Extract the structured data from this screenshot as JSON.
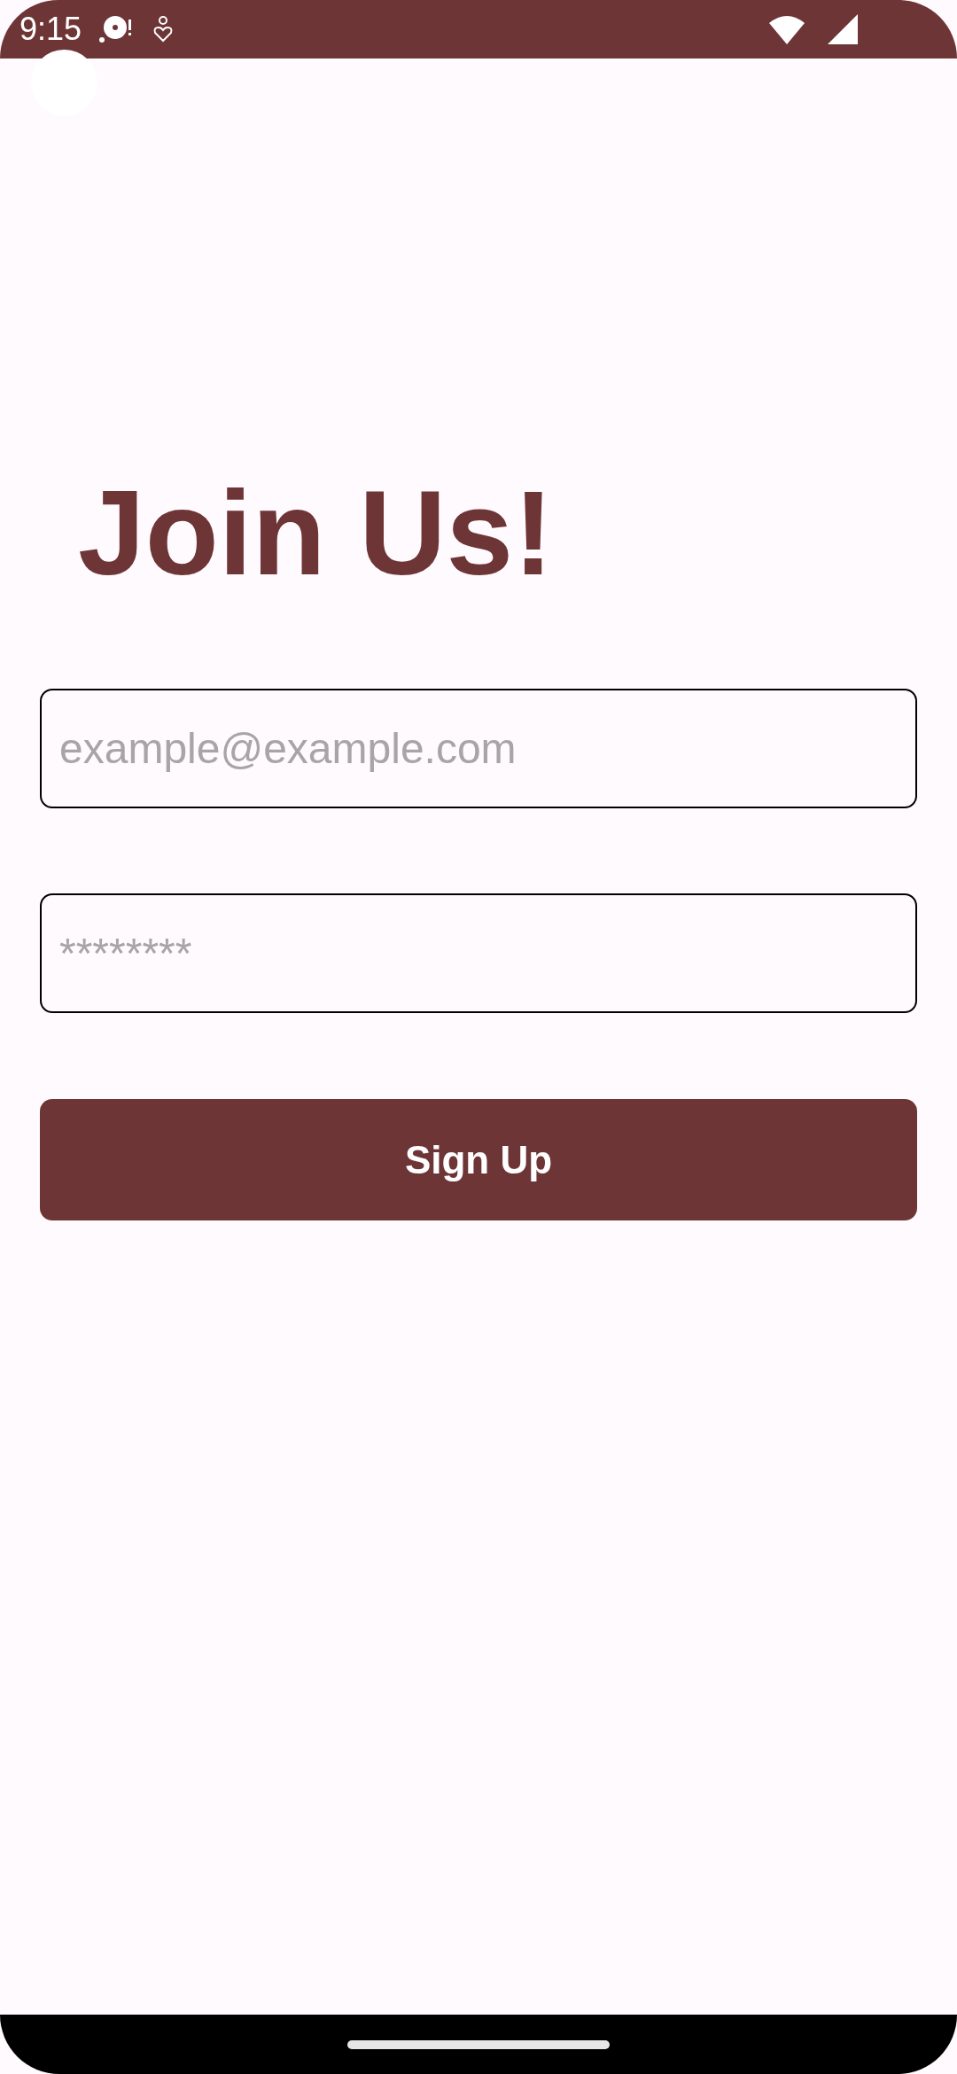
{
  "status_bar": {
    "time": "9:15"
  },
  "title": "Join Us!",
  "email_field": {
    "placeholder": "example@example.com"
  },
  "password_field": {
    "placeholder": "********"
  },
  "sign_up_button": {
    "label": "Sign Up"
  }
}
